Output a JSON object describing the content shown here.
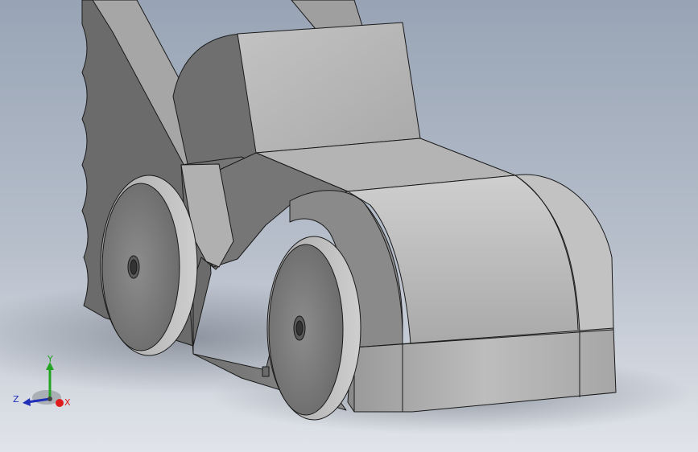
{
  "viewport": {
    "background_top": "#9aa6b6",
    "background_bottom": "#dfe2e8",
    "model_face_light": "#b9b9b9",
    "model_face_mid": "#9c9c9c",
    "model_face_dark": "#6f6f6f",
    "edge_color": "#1a1a1a"
  },
  "triad": {
    "x_label": "X",
    "y_label": "Y",
    "z_label": "Z",
    "x_color": "#e01b1b",
    "y_color": "#22a322",
    "z_color": "#1f2fb8"
  }
}
